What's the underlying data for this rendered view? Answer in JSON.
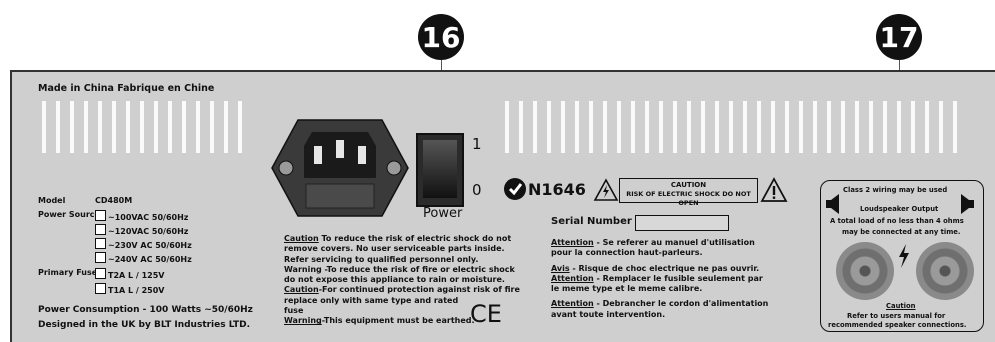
{
  "callouts": {
    "left": "16",
    "right": "17"
  },
  "made_in": "Made in China   Fabrique en Chine",
  "switch": {
    "on_mark": "1",
    "off_mark": "0",
    "label": "Power"
  },
  "spec": {
    "model_label": "Model",
    "model_value": "CD480M",
    "power_source_label": "Power Source",
    "voltages": [
      "~100VAC 50/60Hz",
      "~120VAC 50/60Hz",
      "~230V AC 50/60Hz",
      "~240V AC 50/60Hz"
    ],
    "fuse_label": "Primary Fuse",
    "fuses": [
      "T2A L / 125V",
      "T1A L / 250V"
    ],
    "consumption": "Power Consumption - 100 Watts  ~50/60Hz",
    "designed": "Designed in the UK by BLT Industries LTD."
  },
  "cert": {
    "ctick": "N1646",
    "ce": "CE"
  },
  "caution_badge": {
    "title": "CAUTION",
    "text": "RISK OF ELECTRIC SHOCK DO NOT OPEN"
  },
  "serial_label": "Serial Number",
  "english_warnings": {
    "l1_head": "Caution",
    "l1_rest": " To reduce the risk of electric shock do not",
    "l2": "remove covers. No user serviceable parts inside.",
    "l3": "Refer servicing to qualified personnel only.",
    "l4": "Warning -To reduce the risk of fire or electric shock",
    "l5": "do not expose this appliance to rain or moisture.",
    "l6_head": "Caution",
    "l6_rest": "-For continued protection against risk of fire",
    "l7": "replace only with same type and rated",
    "l8": "fuse",
    "l9_head": "Warning",
    "l9_rest": "-This equipment must be earthed."
  },
  "french_warnings": {
    "l1_head": "Attention",
    "l1_rest": " - Se referer au manuel d'utilisation",
    "l2": "pour la connection haut-parleurs.",
    "l3_head": "Avis",
    "l3_rest": " - Risque de choc electrique ne pas ouvrir.",
    "l4_head": "Attention",
    "l4_rest": " - Remplacer le fusible seulement par",
    "l5": "le meme type et le meme calibre.",
    "l6_head": "Attention",
    "l6_rest": " - Debrancher le cordon d'alimentation",
    "l7": "avant toute intervention."
  },
  "speaker": {
    "line1": "Class 2 wiring may be used",
    "line2": "Loudspeaker Output",
    "line3": "A total load of no less than 4 ohms",
    "line4": "may be connected at any time.",
    "caution": "Caution",
    "ref1": "Refer to users manual for",
    "ref2": "recommended speaker connections."
  }
}
